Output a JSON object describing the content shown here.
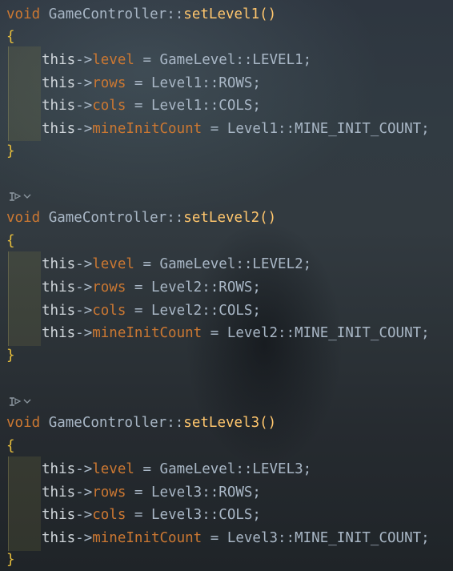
{
  "blocks": [
    {
      "signature": {
        "void": "void",
        "class": "GameController",
        "sep": "::",
        "func": "setLevel1",
        "parens": "()"
      },
      "open_brace": "{",
      "close_brace": "}",
      "lines": [
        {
          "this": "this",
          "arrow": "->",
          "field": "level",
          "eq": " = ",
          "value": "GameLevel::LEVEL1;"
        },
        {
          "this": "this",
          "arrow": "->",
          "field": "rows",
          "eq": " = ",
          "value": "Level1::ROWS;"
        },
        {
          "this": "this",
          "arrow": "->",
          "field": "cols",
          "eq": " = ",
          "value": "Level1::COLS;"
        },
        {
          "this": "this",
          "arrow": "->",
          "field": "mineInitCount",
          "eq": " = ",
          "value": "Level1::MINE_INIT_COUNT;"
        }
      ]
    },
    {
      "hint_icon": "inheritance-hint-icon",
      "signature": {
        "void": "void",
        "class": "GameController",
        "sep": "::",
        "func": "setLevel2",
        "parens": "()"
      },
      "open_brace": "{",
      "close_brace": "}",
      "lines": [
        {
          "this": "this",
          "arrow": "->",
          "field": "level",
          "eq": " = ",
          "value": "GameLevel::LEVEL2;"
        },
        {
          "this": "this",
          "arrow": "->",
          "field": "rows",
          "eq": " = ",
          "value": "Level2::ROWS;"
        },
        {
          "this": "this",
          "arrow": "->",
          "field": "cols",
          "eq": " = ",
          "value": "Level2::COLS;"
        },
        {
          "this": "this",
          "arrow": "->",
          "field": "mineInitCount",
          "eq": " = ",
          "value": "Level2::MINE_INIT_COUNT;"
        }
      ]
    },
    {
      "hint_icon": "inheritance-hint-icon",
      "signature": {
        "void": "void",
        "class": "GameController",
        "sep": "::",
        "func": "setLevel3",
        "parens": "()"
      },
      "open_brace": "{",
      "close_brace": "}",
      "lines": [
        {
          "this": "this",
          "arrow": "->",
          "field": "level",
          "eq": " = ",
          "value": "GameLevel::LEVEL3;"
        },
        {
          "this": "this",
          "arrow": "->",
          "field": "rows",
          "eq": " = ",
          "value": "Level3::ROWS;"
        },
        {
          "this": "this",
          "arrow": "->",
          "field": "cols",
          "eq": " = ",
          "value": "Level3::COLS;"
        },
        {
          "this": "this",
          "arrow": "->",
          "field": "mineInitCount",
          "eq": " = ",
          "value": "Level3::MINE_INIT_COUNT;"
        }
      ]
    }
  ],
  "colors": {
    "keyword": "#cc7832",
    "function": "#ffc66d",
    "text": "#a9b7c6",
    "brace": "#e8bf3c"
  }
}
